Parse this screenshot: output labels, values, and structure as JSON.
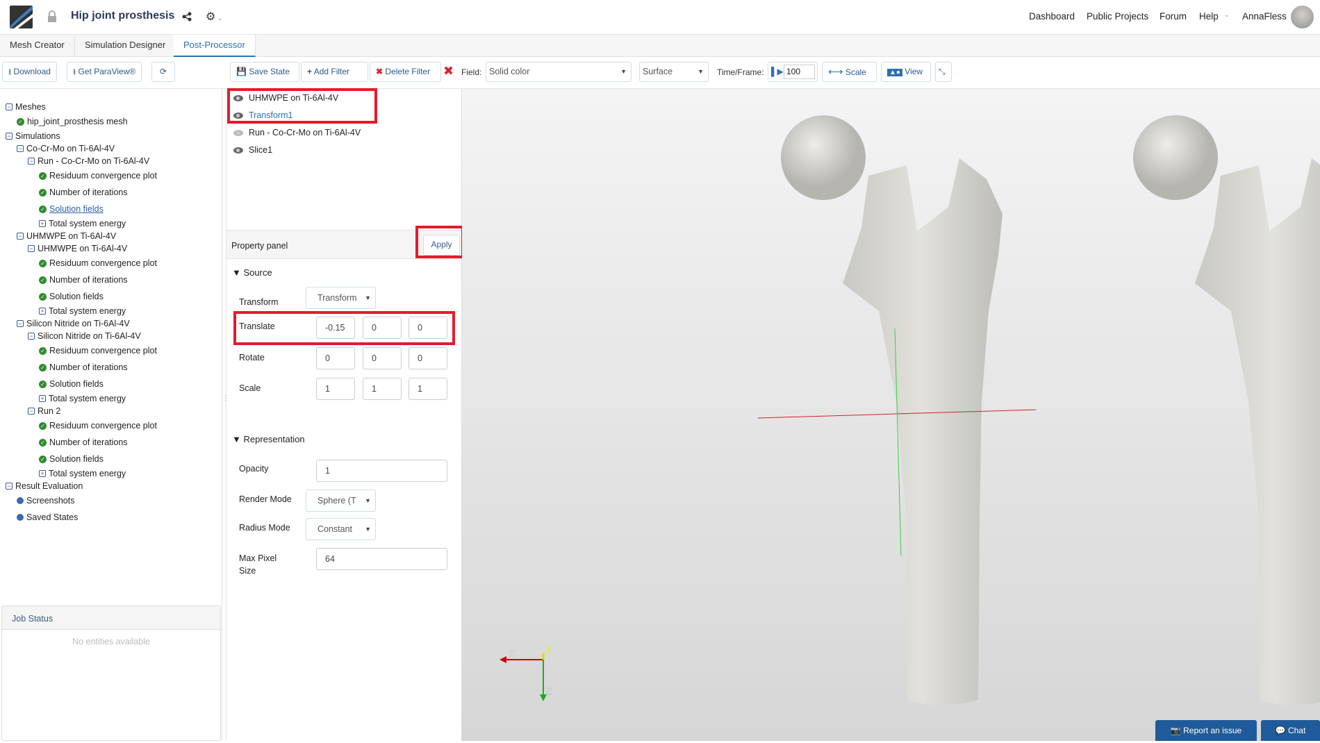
{
  "header": {
    "project_title": "Hip joint prosthesis",
    "nav": [
      "Dashboard",
      "Public Projects",
      "Forum",
      "Help"
    ],
    "user": "AnnaFless"
  },
  "tabs": [
    "Mesh Creator",
    "Simulation Designer",
    "Post-Processor"
  ],
  "left_toolbar": {
    "download": "Download",
    "paraview": "Get ParaView®"
  },
  "toolbar": {
    "save_state": "Save State",
    "add_filter": "Add Filter",
    "delete_filter": "Delete Filter",
    "field_label": "Field:",
    "field_value": "Solid color",
    "repr_value": "Surface",
    "time_label": "Time/Frame:",
    "time_value": "100",
    "scale": "Scale",
    "view": "View"
  },
  "tree": [
    {
      "t": "Meshes",
      "lvl": 0,
      "i": "minus"
    },
    {
      "t": "hip_joint_prosthesis mesh",
      "lvl": 1,
      "i": "ok"
    },
    {
      "t": "Simulations",
      "lvl": 0,
      "i": "minus"
    },
    {
      "t": "Co-Cr-Mo on Ti-6Al-4V",
      "lvl": 1,
      "i": "minus"
    },
    {
      "t": "Run - Co-Cr-Mo on Ti-6Al-4V",
      "lvl": 2,
      "i": "minus"
    },
    {
      "t": "Residuum convergence plot",
      "lvl": 3,
      "i": "ok"
    },
    {
      "t": "Number of iterations",
      "lvl": 3,
      "i": "ok"
    },
    {
      "t": "Solution fields",
      "lvl": 3,
      "i": "ok",
      "link": true
    },
    {
      "t": "Total system energy",
      "lvl": 3,
      "i": "plus"
    },
    {
      "t": "UHMWPE on Ti-6Al-4V",
      "lvl": 1,
      "i": "minus"
    },
    {
      "t": "UHMWPE on Ti-6Al-4V",
      "lvl": 2,
      "i": "minus"
    },
    {
      "t": "Residuum convergence plot",
      "lvl": 3,
      "i": "ok"
    },
    {
      "t": "Number of iterations",
      "lvl": 3,
      "i": "ok"
    },
    {
      "t": "Solution fields",
      "lvl": 3,
      "i": "ok"
    },
    {
      "t": "Total system energy",
      "lvl": 3,
      "i": "plus"
    },
    {
      "t": "Silicon Nitride on Ti-6Al-4V",
      "lvl": 1,
      "i": "minus"
    },
    {
      "t": "Silicon Nitride on Ti-6Al-4V",
      "lvl": 2,
      "i": "minus"
    },
    {
      "t": "Residuum convergence plot",
      "lvl": 3,
      "i": "ok"
    },
    {
      "t": "Number of iterations",
      "lvl": 3,
      "i": "ok"
    },
    {
      "t": "Solution fields",
      "lvl": 3,
      "i": "ok"
    },
    {
      "t": "Total system energy",
      "lvl": 3,
      "i": "plus"
    },
    {
      "t": "Run 2",
      "lvl": 2,
      "i": "minus"
    },
    {
      "t": "Residuum convergence plot",
      "lvl": 3,
      "i": "ok"
    },
    {
      "t": "Number of iterations",
      "lvl": 3,
      "i": "ok"
    },
    {
      "t": "Solution fields",
      "lvl": 3,
      "i": "ok"
    },
    {
      "t": "Total system energy",
      "lvl": 3,
      "i": "plus"
    },
    {
      "t": "Result Evaluation",
      "lvl": 0,
      "i": "minus"
    },
    {
      "t": "Screenshots",
      "lvl": 1,
      "i": "dot"
    },
    {
      "t": "Saved States",
      "lvl": 1,
      "i": "dot"
    }
  ],
  "job_status": {
    "title": "Job Status",
    "empty": "No entities available"
  },
  "pipeline": [
    {
      "t": "UHMWPE on Ti-6Al-4V"
    },
    {
      "t": "Transform1",
      "selected": true
    },
    {
      "t": "Run - Co-Cr-Mo on Ti-6Al-4V",
      "hidden": true
    },
    {
      "t": "Slice1"
    }
  ],
  "property": {
    "title": "Property panel",
    "apply": "Apply",
    "source": "Source",
    "transform_label": "Transform",
    "transform_value": "Transform",
    "translate_label": "Translate",
    "translate": [
      "-0.15",
      "0",
      "0"
    ],
    "rotate_label": "Rotate",
    "rotate": [
      "0",
      "0",
      "0"
    ],
    "scale_label": "Scale",
    "scale": [
      "1",
      "1",
      "1"
    ],
    "representation": "Representation",
    "opacity_label": "Opacity",
    "opacity": "1",
    "render_mode_label": "Render Mode",
    "render_mode": "Sphere (T",
    "radius_mode_label": "Radius Mode",
    "radius_mode": "Constant",
    "max_pixel_label_1": "Max Pixel",
    "max_pixel_label_2": "Size",
    "max_pixel": "64"
  },
  "axes": {
    "x": "X",
    "y": "Y",
    "z": "Z"
  },
  "footer": {
    "report": "Report an issue",
    "chat": "Chat"
  },
  "colors": {
    "accent": "#2b70b0",
    "highlight": "#e8192c",
    "footer_btn": "#1f5b9a"
  }
}
